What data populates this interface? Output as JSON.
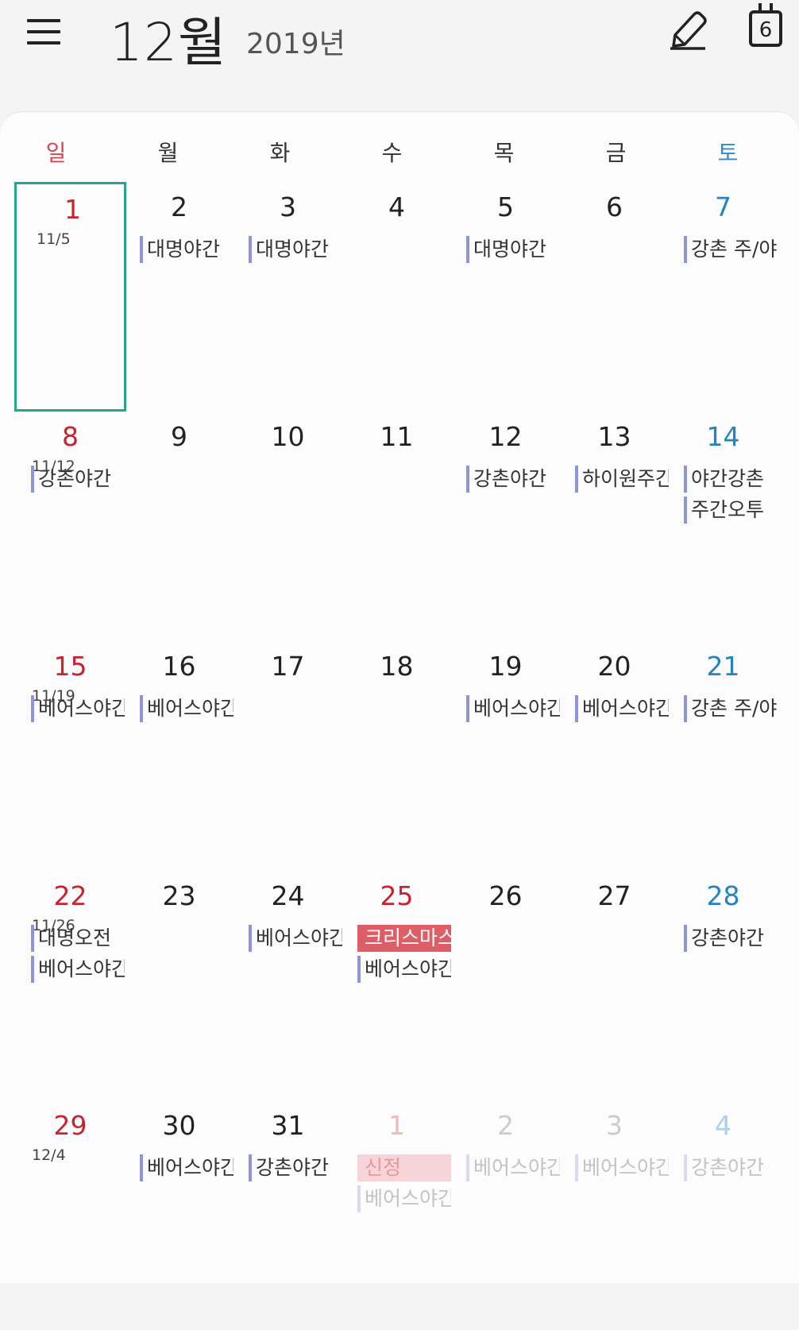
{
  "header": {
    "month": "12월",
    "year": "2019년",
    "today_day": "6",
    "menu_icon": "hamburger-menu-icon",
    "edit_icon": "pencil-icon",
    "today_icon": "calendar-today-icon"
  },
  "weekdays": [
    "일",
    "월",
    "화",
    "수",
    "목",
    "금",
    "토"
  ],
  "colors": {
    "sunday": "#c9232f",
    "saturday": "#2484bf",
    "event_bar": "#8d95d6",
    "holiday": "#dd5e67",
    "selection": "#27a58a"
  },
  "weeks": [
    [
      {
        "day": "1",
        "lunar": "11/5",
        "selected": true,
        "events": []
      },
      {
        "day": "2",
        "events": [
          {
            "text": "대명야간"
          }
        ]
      },
      {
        "day": "3",
        "events": [
          {
            "text": "대명야간"
          }
        ]
      },
      {
        "day": "4",
        "events": []
      },
      {
        "day": "5",
        "events": [
          {
            "text": "대명야간"
          }
        ]
      },
      {
        "day": "6",
        "events": []
      },
      {
        "day": "7",
        "events": [
          {
            "text": "강촌 주/야"
          }
        ]
      }
    ],
    [
      {
        "day": "8",
        "lunar": "11/12",
        "events": [
          {
            "text": "강촌야간"
          }
        ]
      },
      {
        "day": "9",
        "events": []
      },
      {
        "day": "10",
        "events": []
      },
      {
        "day": "11",
        "events": []
      },
      {
        "day": "12",
        "events": [
          {
            "text": "강촌야간"
          }
        ]
      },
      {
        "day": "13",
        "events": [
          {
            "text": "하이원주간"
          }
        ]
      },
      {
        "day": "14",
        "events": [
          {
            "text": "야간강촌"
          },
          {
            "text": "주간오투"
          }
        ]
      }
    ],
    [
      {
        "day": "15",
        "lunar": "11/19",
        "events": [
          {
            "text": "베어스야간"
          }
        ]
      },
      {
        "day": "16",
        "events": [
          {
            "text": "베어스야간"
          }
        ]
      },
      {
        "day": "17",
        "events": []
      },
      {
        "day": "18",
        "events": []
      },
      {
        "day": "19",
        "events": [
          {
            "text": "베어스야간"
          }
        ]
      },
      {
        "day": "20",
        "events": [
          {
            "text": "베어스야간"
          }
        ]
      },
      {
        "day": "21",
        "events": [
          {
            "text": "강촌 주/야"
          }
        ]
      }
    ],
    [
      {
        "day": "22",
        "lunar": "11/26",
        "events": [
          {
            "text": "대명오전"
          },
          {
            "text": "베어스야간"
          }
        ]
      },
      {
        "day": "23",
        "events": []
      },
      {
        "day": "24",
        "events": [
          {
            "text": "베어스야간"
          }
        ]
      },
      {
        "day": "25",
        "red": true,
        "events": [
          {
            "text": "크리스마스",
            "holiday": true
          },
          {
            "text": "베어스야간"
          }
        ]
      },
      {
        "day": "26",
        "events": []
      },
      {
        "day": "27",
        "events": []
      },
      {
        "day": "28",
        "events": [
          {
            "text": "강촌야간"
          }
        ]
      }
    ],
    [
      {
        "day": "29",
        "lunar": "12/4",
        "events": []
      },
      {
        "day": "30",
        "events": [
          {
            "text": "베어스야간"
          }
        ]
      },
      {
        "day": "31",
        "events": [
          {
            "text": "강촌야간"
          }
        ]
      },
      {
        "day": "1",
        "other": true,
        "red": true,
        "events": [
          {
            "text": "신정",
            "holiday": true
          },
          {
            "text": "베어스야간"
          }
        ]
      },
      {
        "day": "2",
        "other": true,
        "events": [
          {
            "text": "베어스야간"
          }
        ]
      },
      {
        "day": "3",
        "other": true,
        "events": [
          {
            "text": "베어스야간"
          }
        ]
      },
      {
        "day": "4",
        "other": true,
        "events": [
          {
            "text": "강촌야간"
          }
        ]
      }
    ]
  ]
}
